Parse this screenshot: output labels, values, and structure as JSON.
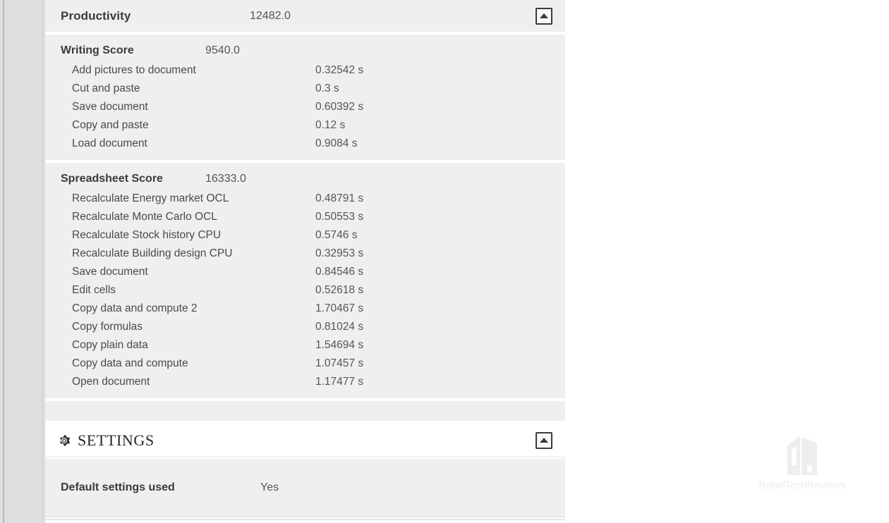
{
  "report": {
    "main_section": {
      "title": "Productivity",
      "score": "12482.0",
      "collapse_icon": "collapse-up-icon",
      "groups": [
        {
          "name": "Writing Score",
          "score": "9540.0",
          "rows": [
            {
              "label": "Add pictures to document",
              "value": "0.32542 s"
            },
            {
              "label": "Cut and paste",
              "value": "0.3 s"
            },
            {
              "label": "Save document",
              "value": "0.60392 s"
            },
            {
              "label": "Copy and paste",
              "value": "0.12 s"
            },
            {
              "label": "Load document",
              "value": "0.9084 s"
            }
          ]
        },
        {
          "name": "Spreadsheet Score",
          "score": "16333.0",
          "rows": [
            {
              "label": "Recalculate Energy market OCL",
              "value": "0.48791 s"
            },
            {
              "label": "Recalculate Monte Carlo OCL",
              "value": "0.50553 s"
            },
            {
              "label": "Recalculate Stock history CPU",
              "value": "0.5746 s"
            },
            {
              "label": "Recalculate Building design CPU",
              "value": "0.32953 s"
            },
            {
              "label": "Save document",
              "value": "0.84546 s"
            },
            {
              "label": "Edit cells",
              "value": "0.52618 s"
            },
            {
              "label": "Copy data and compute 2",
              "value": "1.70467 s"
            },
            {
              "label": "Copy formulas",
              "value": "0.81024 s"
            },
            {
              "label": "Copy plain data",
              "value": "1.54694 s"
            },
            {
              "label": "Copy data and compute",
              "value": "1.07457 s"
            },
            {
              "label": "Open document",
              "value": "1.17477 s"
            }
          ]
        }
      ]
    },
    "settings_section": {
      "title": "SETTINGS",
      "gear_icon": "gear-icon",
      "collapse_icon": "collapse-up-icon",
      "rows": [
        {
          "label": "Default settings used",
          "value": "Yes"
        }
      ]
    }
  },
  "watermark": {
    "text": "BabelTechReviews",
    "logo_icon": "building-logo-icon"
  },
  "colors": {
    "panel_background": "#efefef",
    "page_background": "#ffffff",
    "gutter": "#dedede",
    "heading_text": "#3b3b3b",
    "body_text": "#4a4a4a",
    "value_text": "#555555",
    "watermark": "#eeeeee"
  }
}
